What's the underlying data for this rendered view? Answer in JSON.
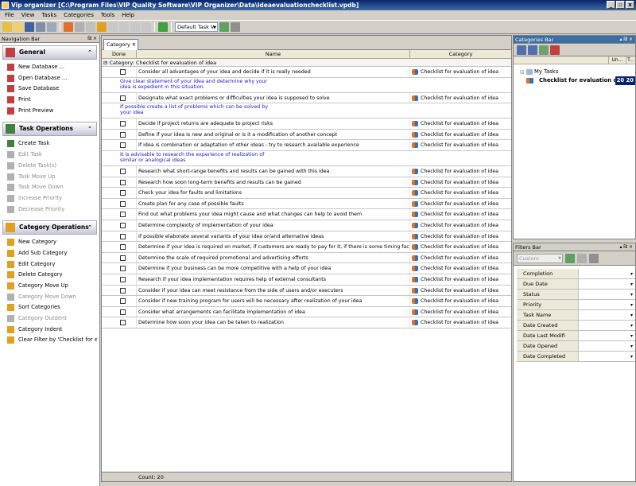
{
  "window": {
    "title": "Vip organizer [C:\\Program Files\\VIP Quality Software\\VIP Organizer\\Data\\Ideaevaluationchecklist.vpdb]",
    "min": "_",
    "max": "▫",
    "close": "x"
  },
  "menu": [
    "File",
    "View",
    "Tasks",
    "Categories",
    "Tools",
    "Help"
  ],
  "toolbar": {
    "view_combo": "Default Task V"
  },
  "nav": {
    "title": "Navigation Bar",
    "pin": "₪ ×",
    "sections": [
      {
        "title": "General",
        "icon": "wrench-icon",
        "color": "#c04040",
        "items": [
          {
            "label": "New Database ...",
            "disabled": false
          },
          {
            "label": "Open Database ...",
            "disabled": false
          },
          {
            "label": "Save Database",
            "disabled": false
          },
          {
            "label": "Print",
            "disabled": false
          },
          {
            "label": "Print Preview",
            "disabled": false
          }
        ]
      },
      {
        "title": "Task Operations",
        "icon": "checklist-icon",
        "color": "#408040",
        "items": [
          {
            "label": "Create Task",
            "disabled": false
          },
          {
            "label": "Edit Task",
            "disabled": true
          },
          {
            "label": "Delete Task(s)",
            "disabled": true
          },
          {
            "label": "Task Move Up",
            "disabled": true
          },
          {
            "label": "Task Move Down",
            "disabled": true
          },
          {
            "label": "Increase Priority",
            "disabled": true
          },
          {
            "label": "Decrease Priority",
            "disabled": true
          }
        ]
      },
      {
        "title": "Category Operations",
        "icon": "folder-icon",
        "color": "#e0a020",
        "items": [
          {
            "label": "New Category",
            "disabled": false
          },
          {
            "label": "Add Sub Category",
            "disabled": false
          },
          {
            "label": "Edit Category",
            "disabled": false
          },
          {
            "label": "Delete Category",
            "disabled": false
          },
          {
            "label": "Category Move Up",
            "disabled": false
          },
          {
            "label": "Category Move Down",
            "disabled": true
          },
          {
            "label": "Sort Categories",
            "disabled": false
          },
          {
            "label": "Category Outdent",
            "disabled": true
          },
          {
            "label": "Category Indent",
            "disabled": false
          },
          {
            "label": "Clear Filter by 'Checklist for ev...",
            "disabled": false
          }
        ]
      }
    ]
  },
  "main": {
    "tab": "Category",
    "columns": [
      "Done",
      "Name",
      "Category"
    ],
    "group_label": "Category: Checklist for evaluation of idea",
    "category_name": "Checklist for evaluation of idea",
    "rows": [
      {
        "name": "Consider all advantages of your idea and decide if it is really needed",
        "note": "Give clear statement of your idea and determine why your\nidea is expedient in this situation."
      },
      {
        "name": "Designate what exact problems or difficulties your idea is supposed to solve",
        "note": "If possible create a list of problems which can be solved by\nyour idea"
      },
      {
        "name": "Decide if project returns are adequate to project risks",
        "note": ""
      },
      {
        "name": "Define if your idea is new and original or is it a modification of another concept",
        "note": ""
      },
      {
        "name": "If idea is combination or adaptation of other ideas - try to research available experience",
        "note": "It is advisable to research the experience of realization of\nsimilar or analogical ideas"
      },
      {
        "name": "Research what short-range benefits and results can be gained with this idea",
        "note": ""
      },
      {
        "name": "Research how soon long-term benefits and results can be gained",
        "note": ""
      },
      {
        "name": "Check your idea for faults and limitations",
        "note": ""
      },
      {
        "name": "Create plan for any case of possible faults",
        "note": ""
      },
      {
        "name": "Find out what problems your idea might cause and what changes can help to avoid them",
        "note": ""
      },
      {
        "name": "Determine complexity of implementation of your idea",
        "note": ""
      },
      {
        "name": "If possible elaborate several variants of your idea or/and alternative ideas",
        "note": ""
      },
      {
        "name": "Determine if your idea is required on market, if customers are ready to pay for it, if there is some timing factor",
        "note": ""
      },
      {
        "name": "Determine the scale of required promotional and advertising efforts",
        "note": ""
      },
      {
        "name": "Determine if your business can be more competitive with a help of your idea",
        "note": ""
      },
      {
        "name": "Research if your idea implementation requires help of external consultants",
        "note": ""
      },
      {
        "name": "Consider if your idea can meet resistance from the side of users and/or executers",
        "note": ""
      },
      {
        "name": "Consider if new training program for users will be necessary after realization of your idea",
        "note": ""
      },
      {
        "name": "Consider what arrangements can facilitate implementation of idea",
        "note": ""
      },
      {
        "name": "Determine how soon your idea can be taken to realization",
        "note": ""
      }
    ],
    "count": "Count: 20"
  },
  "categories": {
    "title": "Categories Bar",
    "ctl": "▴ ₪ ×",
    "col_un": "Un...",
    "col_t": "T...",
    "root": "My Tasks",
    "selected": "Checklist for evaluation o",
    "un": "20",
    "t": "20"
  },
  "filters": {
    "title": "Filters Bar",
    "ctl": "▴ ₪ ×",
    "combo": "Custom",
    "fields": [
      "Completion",
      "Due Date",
      "Status",
      "Priority",
      "Task Name",
      "Date Created",
      "Date Last Modifi",
      "Date Opened",
      "Date Completed"
    ]
  },
  "colors": {
    "accent": "#3a6ea5",
    "note_text": "#1a1acc"
  }
}
